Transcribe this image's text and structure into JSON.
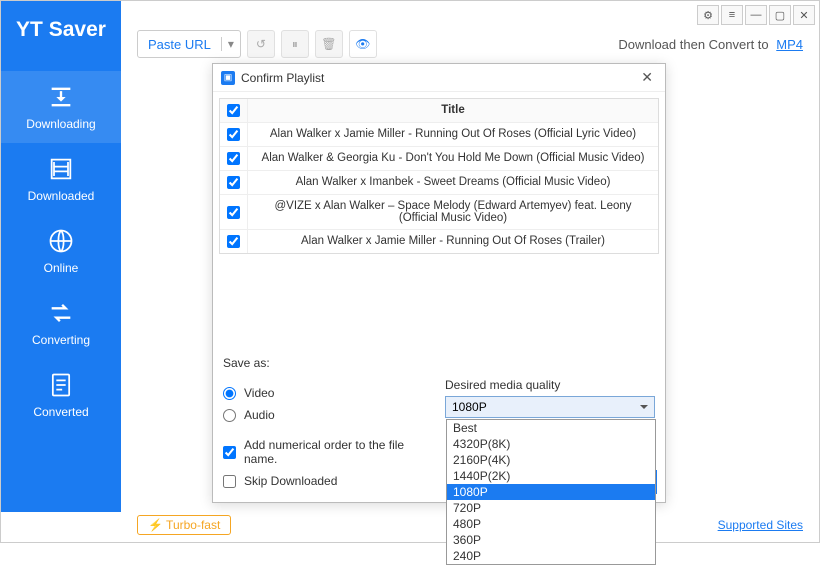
{
  "app_name": "YT Saver",
  "toolbar": {
    "paste_label": "Paste URL",
    "download_convert_text": "Download then Convert to",
    "convert_format": "MP4"
  },
  "sidebar": {
    "items": [
      {
        "label": "Downloading"
      },
      {
        "label": "Downloaded"
      },
      {
        "label": "Online"
      },
      {
        "label": "Converting"
      },
      {
        "label": "Converted"
      }
    ]
  },
  "footer": {
    "turbo_label": "⚡ Turbo-fast",
    "supported_label": "Supported Sites"
  },
  "modal": {
    "title": "Confirm Playlist",
    "header_title": "Title",
    "items": [
      {
        "title": "Alan Walker x Jamie Miller - Running Out Of Roses (Official Lyric Video)"
      },
      {
        "title": "Alan Walker & Georgia Ku - Don't You Hold Me Down (Official Music Video)"
      },
      {
        "title": "Alan Walker x Imanbek - Sweet Dreams (Official Music Video)"
      },
      {
        "title": "@VIZE  x Alan Walker – Space Melody (Edward Artemyev) feat. Leony (Official Music Video)"
      },
      {
        "title": "Alan Walker x Jamie Miller - Running Out Of Roses (Trailer)"
      }
    ],
    "save_as_label": "Save as:",
    "radio_video": "Video",
    "radio_audio": "Audio",
    "chk_numerical": "Add numerical order to the file name.",
    "chk_skip": "Skip Downloaded",
    "quality_label": "Desired media quality",
    "quality_value": "1080P",
    "quality_options": [
      "Best",
      "4320P(8K)",
      "2160P(4K)",
      "1440P(2K)",
      "1080P",
      "720P",
      "480P",
      "360P",
      "240P"
    ]
  }
}
